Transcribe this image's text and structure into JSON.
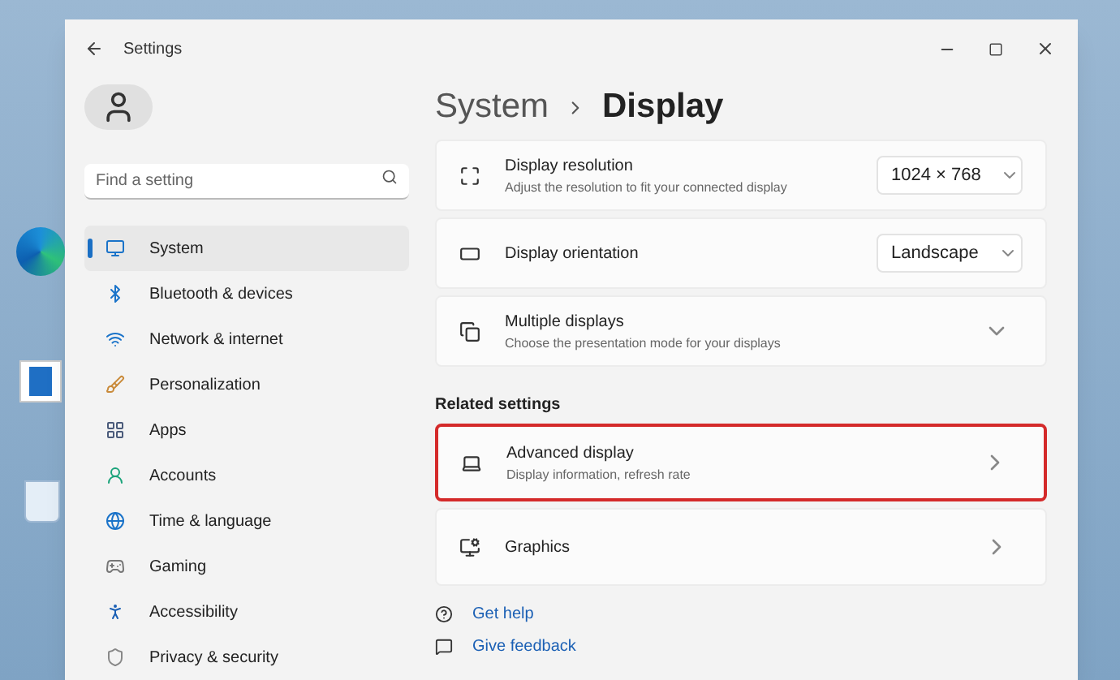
{
  "window": {
    "title": "Settings"
  },
  "sidebar": {
    "search": {
      "placeholder": "Find a setting"
    },
    "items": [
      {
        "label": "System",
        "selected": true
      },
      {
        "label": "Bluetooth & devices",
        "selected": false
      },
      {
        "label": "Network & internet",
        "selected": false
      },
      {
        "label": "Personalization",
        "selected": false
      },
      {
        "label": "Apps",
        "selected": false
      },
      {
        "label": "Accounts",
        "selected": false
      },
      {
        "label": "Time & language",
        "selected": false
      },
      {
        "label": "Gaming",
        "selected": false
      },
      {
        "label": "Accessibility",
        "selected": false
      },
      {
        "label": "Privacy & security",
        "selected": false
      }
    ]
  },
  "breadcrumb": {
    "parent": "System",
    "current": "Display"
  },
  "cards": [
    {
      "kind": "dropdown",
      "title": "Display resolution",
      "description": "Adjust the resolution to fit your connected display",
      "value": "1024 × 768"
    },
    {
      "kind": "dropdown",
      "title": "Display orientation",
      "value": "Landscape"
    },
    {
      "kind": "expand",
      "title": "Multiple displays",
      "description": "Choose the presentation mode for your displays"
    }
  ],
  "related_settings": {
    "heading": "Related settings",
    "cards": [
      {
        "kind": "link",
        "title": "Advanced display",
        "description": "Display information, refresh rate",
        "highlighted": true
      },
      {
        "kind": "link",
        "title": "Graphics",
        "highlighted": false
      }
    ]
  },
  "help_links": [
    "Get help",
    "Give feedback"
  ]
}
